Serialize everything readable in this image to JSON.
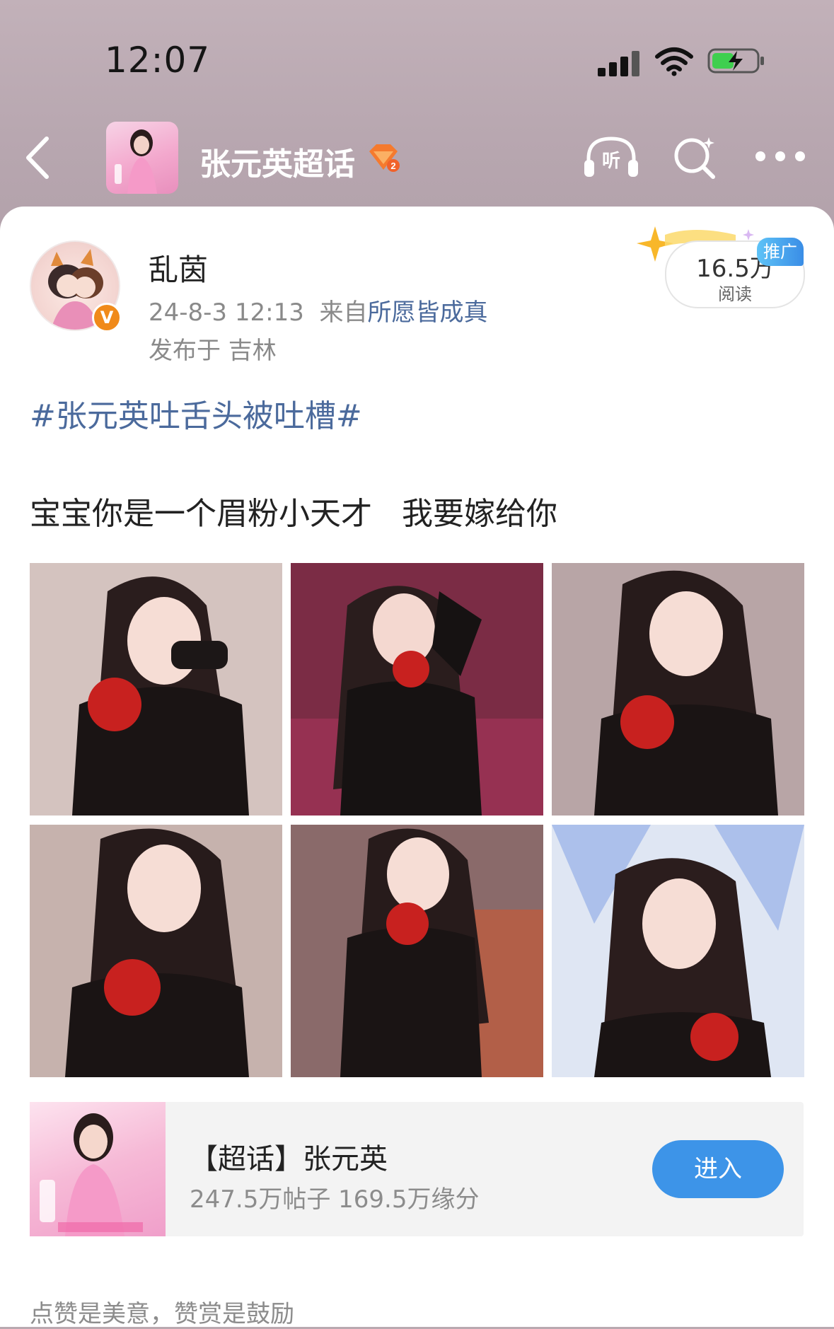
{
  "status_bar": {
    "time": "12:07"
  },
  "header": {
    "topic_title": "张元英超话",
    "badge_level": "2"
  },
  "post": {
    "author": "乱茵",
    "verified_badge": "V",
    "time": "24-8-3 12:13",
    "source_prefix": "来自",
    "source": "所愿皆成真",
    "location": "发布于 吉林",
    "read_count": "16.5万",
    "read_label": "阅读",
    "promo_label": "推广",
    "hashtag": "#张元英吐舌头被吐槽#",
    "text": "宝宝你是一个眉粉小天才   我要嫁给你",
    "photos": [
      {
        "name": "photo-1",
        "bg": "#c9b8b6"
      },
      {
        "name": "photo-2",
        "bg": "#7b2c45"
      },
      {
        "name": "photo-3",
        "bg": "#b8a5a6"
      },
      {
        "name": "photo-4",
        "bg": "#c6b2ad"
      },
      {
        "name": "photo-5",
        "bg": "#8a6a6a"
      },
      {
        "name": "photo-6",
        "bg": "#dfe6f3"
      }
    ]
  },
  "topic_card": {
    "title": "【超话】张元英",
    "stats": "247.5万帖子 169.5万缘分",
    "enter_label": "进入"
  },
  "footer": {
    "text": "点赞是美意，赞赏是鼓励"
  },
  "colors": {
    "link": "#4b6a9c",
    "button": "#3d94e8",
    "header_bg": "#bba9b2"
  }
}
